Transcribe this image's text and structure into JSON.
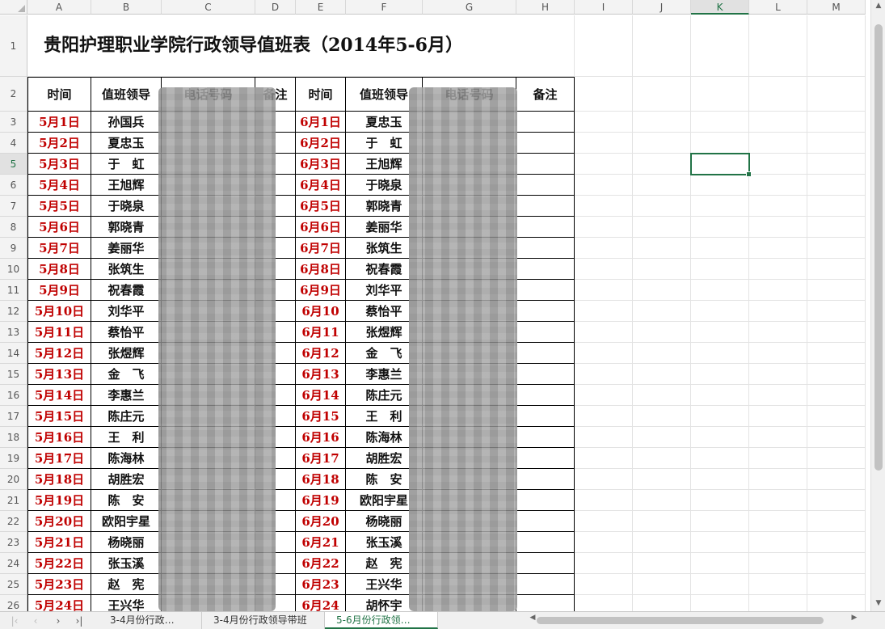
{
  "columns": [
    "A",
    "B",
    "C",
    "D",
    "E",
    "F",
    "G",
    "H",
    "I",
    "J",
    "K",
    "L",
    "M"
  ],
  "selected_column": "K",
  "selected_row": "5",
  "rows": [
    "1",
    "2",
    "3",
    "4",
    "5",
    "6",
    "7",
    "8",
    "9",
    "10",
    "11",
    "12",
    "13",
    "14",
    "15",
    "16",
    "17",
    "18",
    "19",
    "20",
    "21",
    "22",
    "23",
    "24",
    "25",
    "26"
  ],
  "title": "贵阳护理职业学院行政领导值班表（2014年5-6月）",
  "headers": [
    "时间",
    "值班领导",
    "电话号码",
    "备注",
    "时间",
    "值班领导",
    "电话号码",
    "备注"
  ],
  "may": [
    {
      "date": "5月1日",
      "name": "孙国兵"
    },
    {
      "date": "5月2日",
      "name": "夏忠玉"
    },
    {
      "date": "5月3日",
      "name": "于　虹"
    },
    {
      "date": "5月4日",
      "name": "王旭辉"
    },
    {
      "date": "5月5日",
      "name": "于晓泉"
    },
    {
      "date": "5月6日",
      "name": "郭晓青"
    },
    {
      "date": "5月7日",
      "name": "姜丽华"
    },
    {
      "date": "5月8日",
      "name": "张筑生"
    },
    {
      "date": "5月9日",
      "name": "祝春霞"
    },
    {
      "date": "5月10日",
      "name": "刘华平"
    },
    {
      "date": "5月11日",
      "name": "蔡怡平"
    },
    {
      "date": "5月12日",
      "name": "张煜辉"
    },
    {
      "date": "5月13日",
      "name": "金　飞"
    },
    {
      "date": "5月14日",
      "name": "李惠兰"
    },
    {
      "date": "5月15日",
      "name": "陈庄元"
    },
    {
      "date": "5月16日",
      "name": "王　利"
    },
    {
      "date": "5月17日",
      "name": "陈海林"
    },
    {
      "date": "5月18日",
      "name": "胡胜宏"
    },
    {
      "date": "5月19日",
      "name": "陈　安"
    },
    {
      "date": "5月20日",
      "name": "欧阳宇星"
    },
    {
      "date": "5月21日",
      "name": "杨晓丽"
    },
    {
      "date": "5月22日",
      "name": "张玉溪"
    },
    {
      "date": "5月23日",
      "name": "赵　宪"
    },
    {
      "date": "5月24日",
      "name": "王兴华"
    }
  ],
  "june": [
    {
      "date": "6月1日",
      "name": "夏忠玉"
    },
    {
      "date": "6月2日",
      "name": "于　虹"
    },
    {
      "date": "6月3日",
      "name": "王旭辉"
    },
    {
      "date": "6月4日",
      "name": "于晓泉"
    },
    {
      "date": "6月5日",
      "name": "郭晓青"
    },
    {
      "date": "6月6日",
      "name": "姜丽华"
    },
    {
      "date": "6月7日",
      "name": "张筑生"
    },
    {
      "date": "6月8日",
      "name": "祝春霞"
    },
    {
      "date": "6月9日",
      "name": "刘华平"
    },
    {
      "date": "6月10",
      "name": "蔡怡平"
    },
    {
      "date": "6月11",
      "name": "张煜辉"
    },
    {
      "date": "6月12",
      "name": "金　飞"
    },
    {
      "date": "6月13",
      "name": "李惠兰"
    },
    {
      "date": "6月14",
      "name": "陈庄元"
    },
    {
      "date": "6月15",
      "name": "王　利"
    },
    {
      "date": "6月16",
      "name": "陈海林"
    },
    {
      "date": "6月17",
      "name": "胡胜宏"
    },
    {
      "date": "6月18",
      "name": "陈　安"
    },
    {
      "date": "6月19",
      "name": "欧阳宇星"
    },
    {
      "date": "6月20",
      "name": "杨晓丽"
    },
    {
      "date": "6月21",
      "name": "张玉溪"
    },
    {
      "date": "6月22",
      "name": "赵　宪"
    },
    {
      "date": "6月23",
      "name": "王兴华"
    },
    {
      "date": "6月24",
      "name": "胡怀宇"
    }
  ],
  "sheet_tabs": [
    "3-4月份行政…",
    "3-4月份行政领导带班",
    "5-6月份行政领…"
  ],
  "colors": {
    "accent": "#217346",
    "date_red": "#c00000"
  },
  "icons": {
    "nav_first": "chevron-left-icon",
    "nav_prev": "chevron-left-icon",
    "nav_next": "chevron-right-icon",
    "nav_last": "chevron-last-icon"
  }
}
